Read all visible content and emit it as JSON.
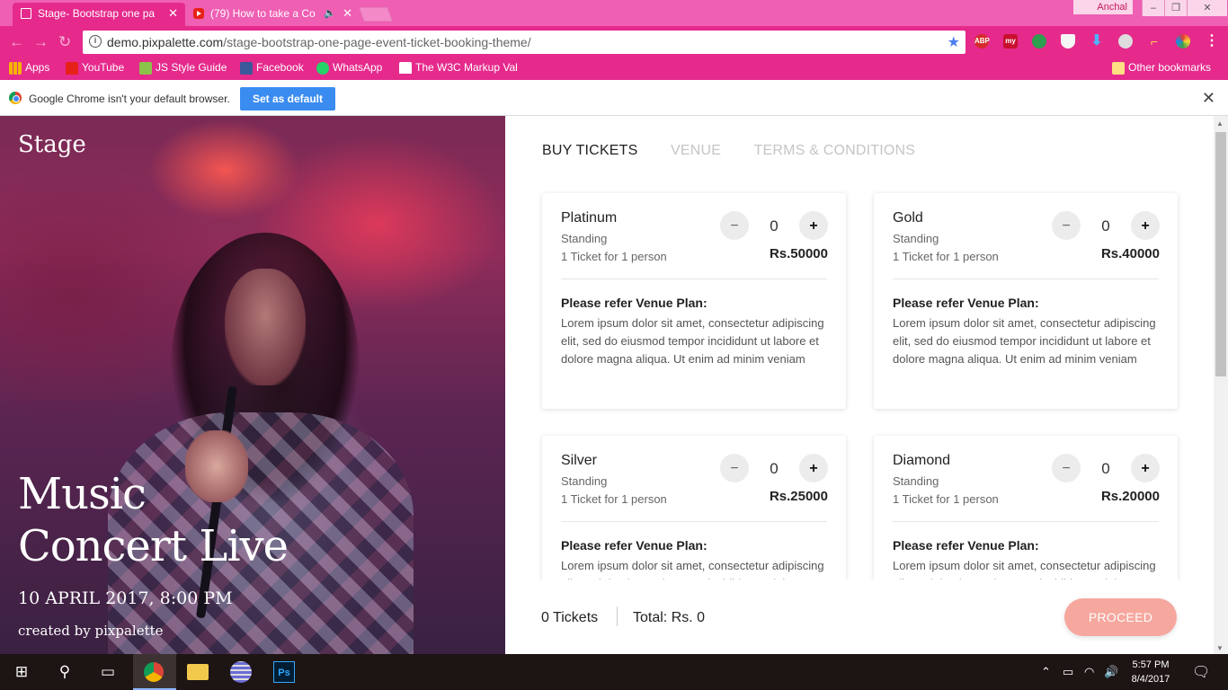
{
  "browser": {
    "tabs": [
      {
        "title": "Stage- Bootstrap one pa",
        "active": true
      },
      {
        "title": "(79) How to take a Co",
        "active": false
      }
    ],
    "profile_name": "Anchal",
    "url_host": "demo.pixpalette.com",
    "url_path": "/stage-bootstrap-one-page-event-ticket-booking-theme/",
    "extensions": [
      "ABP",
      "my"
    ],
    "bookmarks": [
      "Apps",
      "YouTube",
      "JS Style Guide",
      "Facebook",
      "WhatsApp",
      "The W3C Markup Val"
    ],
    "other_bookmarks": "Other bookmarks",
    "infobar_message": "Google Chrome isn't your default browser.",
    "infobar_button": "Set as default"
  },
  "hero": {
    "brand": "Stage",
    "title_line1": "Music",
    "title_line2": "Concert Live",
    "date": "10 APRIL 2017, 8:00 PM",
    "credit": "created by pixpalette"
  },
  "nav": [
    "BUY TICKETS",
    "VENUE",
    "TERMS & CONDITIONS"
  ],
  "tickets": [
    {
      "name": "Platinum",
      "type": "Standing",
      "per": "1 Ticket for 1 person",
      "qty": "0",
      "price": "Rs.50000",
      "refer": "Please refer Venue Plan:",
      "desc": "Lorem ipsum dolor sit amet, consectetur adipiscing elit, sed do eiusmod tempor incididunt ut labore et dolore magna aliqua. Ut enim ad minim veniam"
    },
    {
      "name": "Gold",
      "type": "Standing",
      "per": "1 Ticket for 1 person",
      "qty": "0",
      "price": "Rs.40000",
      "refer": "Please refer Venue Plan:",
      "desc": "Lorem ipsum dolor sit amet, consectetur adipiscing elit, sed do eiusmod tempor incididunt ut labore et dolore magna aliqua. Ut enim ad minim veniam"
    },
    {
      "name": "Silver",
      "type": "Standing",
      "per": "1 Ticket for 1 person",
      "qty": "0",
      "price": "Rs.25000",
      "refer": "Please refer Venue Plan:",
      "desc": "Lorem ipsum dolor sit amet, consectetur adipiscing elit, sed do eiusmod tempor incididunt ut labore et dolore magna aliqua. Ut enim ad minim veniam"
    },
    {
      "name": "Diamond",
      "type": "Standing",
      "per": "1 Ticket for 1 person",
      "qty": "0",
      "price": "Rs.20000",
      "refer": "Please refer Venue Plan:",
      "desc": "Lorem ipsum dolor sit amet, consectetur adipiscing elit, sed do eiusmod tempor incididunt ut labore et dolore magna aliqua. Ut enim ad minim veniam"
    }
  ],
  "stepper": {
    "minus": "−",
    "plus": "+"
  },
  "footer": {
    "count": "0 Tickets",
    "total": "Total: Rs. 0",
    "proceed": "PROCEED"
  },
  "taskbar": {
    "time": "5:57 PM",
    "date": "8/4/2017"
  },
  "colors": {
    "chrome_pink": "#e52a8c",
    "proceed": "#f6a79e",
    "infobar_button": "#3b8cf1"
  }
}
